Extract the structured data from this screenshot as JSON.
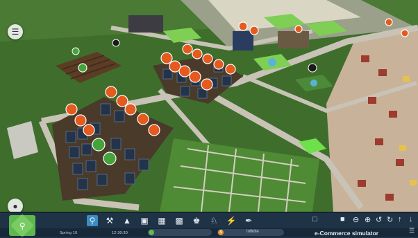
{
  "scene": {
    "title": "e-Commerce simulator"
  },
  "toolbar": {
    "tools": [
      "zoning-icon",
      "roads-icon",
      "terrain-icon",
      "buildings-icon",
      "industry-icon",
      "district-icon",
      "public-icon",
      "monument-icon",
      "electricity-icon",
      "brush-icon"
    ],
    "season": "Spring 10",
    "time": "12:30:30",
    "money": "Infinite",
    "title": "e-Commerce simulator"
  },
  "colors": {
    "bar": "#1f3347",
    "accent_green": "#5fb84d",
    "power_icon": "#e55a1e",
    "people_icon": "#44a33a"
  }
}
